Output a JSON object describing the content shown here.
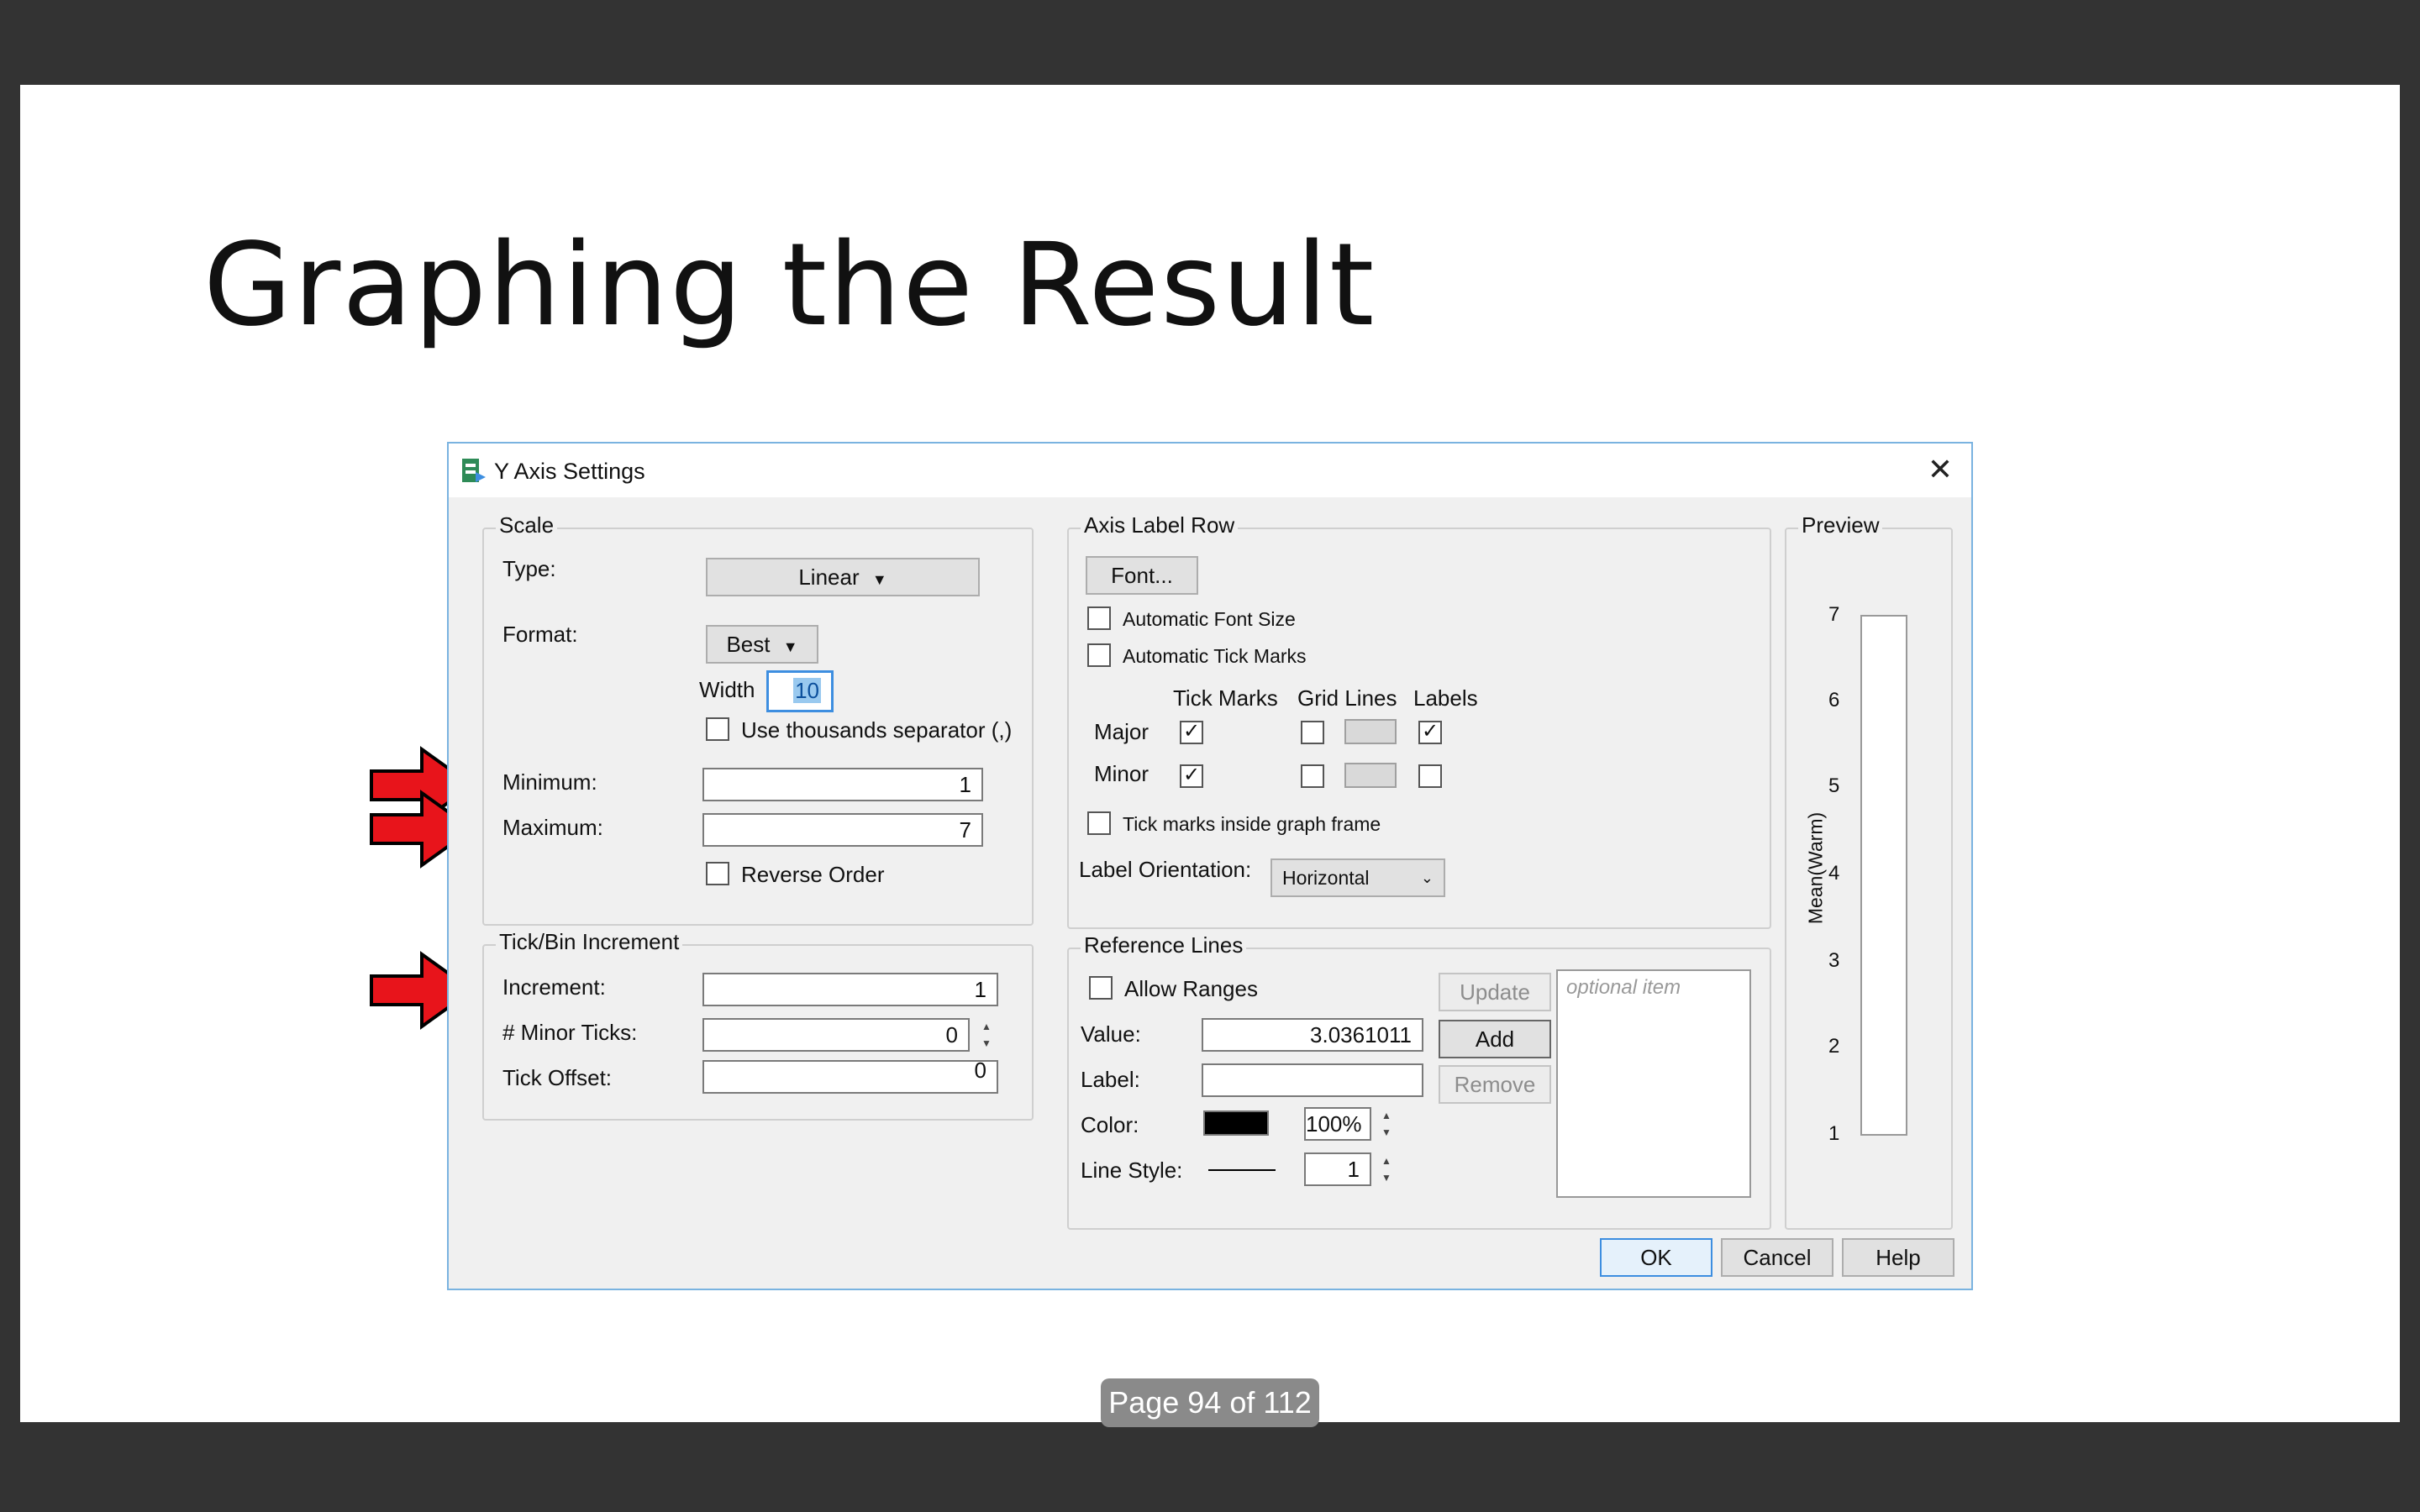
{
  "slide": {
    "title": "Graphing the Result",
    "page_indicator": "Page 94 of 112"
  },
  "dialog": {
    "title": "Y Axis Settings",
    "scale": {
      "legend": "Scale",
      "type_label": "Type:",
      "type_value": "Linear",
      "format_label": "Format:",
      "format_value": "Best",
      "width_label": "Width",
      "width_value": "10",
      "thousands_label": "Use thousands separator (,)",
      "minimum_label": "Minimum:",
      "minimum_value": "1",
      "maximum_label": "Maximum:",
      "maximum_value": "7",
      "reverse_label": "Reverse Order"
    },
    "tick": {
      "legend": "Tick/Bin Increment",
      "increment_label": "Increment:",
      "increment_value": "1",
      "minor_ticks_label": "# Minor Ticks:",
      "minor_ticks_value": "0",
      "offset_label": "Tick Offset:",
      "offset_value": "0"
    },
    "axis_label_row": {
      "legend": "Axis Label Row",
      "font_button": "Font...",
      "auto_font_size": "Automatic Font Size",
      "auto_tick_marks": "Automatic Tick Marks",
      "col_tick_marks": "Tick Marks",
      "col_grid_lines": "Grid Lines",
      "col_labels": "Labels",
      "row_major": "Major",
      "row_minor": "Minor",
      "tick_inside": "Tick marks inside graph frame",
      "orientation_label": "Label Orientation:",
      "orientation_value": "Horizontal"
    },
    "reference_lines": {
      "legend": "Reference Lines",
      "allow_ranges": "Allow Ranges",
      "value_label": "Value:",
      "value": "3.0361011",
      "label_label": "Label:",
      "color_label": "Color:",
      "color_value": "#000000",
      "opacity": "100%",
      "line_style_label": "Line Style:",
      "line_width": "1",
      "update_button": "Update",
      "add_button": "Add",
      "remove_button": "Remove",
      "list_placeholder": "optional item"
    },
    "preview": {
      "legend": "Preview",
      "axis_label": "Mean(Warm)",
      "ticks": [
        "7",
        "6",
        "5",
        "4",
        "3",
        "2",
        "1"
      ]
    },
    "buttons": {
      "ok": "OK",
      "cancel": "Cancel",
      "help": "Help"
    }
  },
  "colors": {
    "arrow": "#e8141b",
    "accent": "#3d8ee0"
  }
}
